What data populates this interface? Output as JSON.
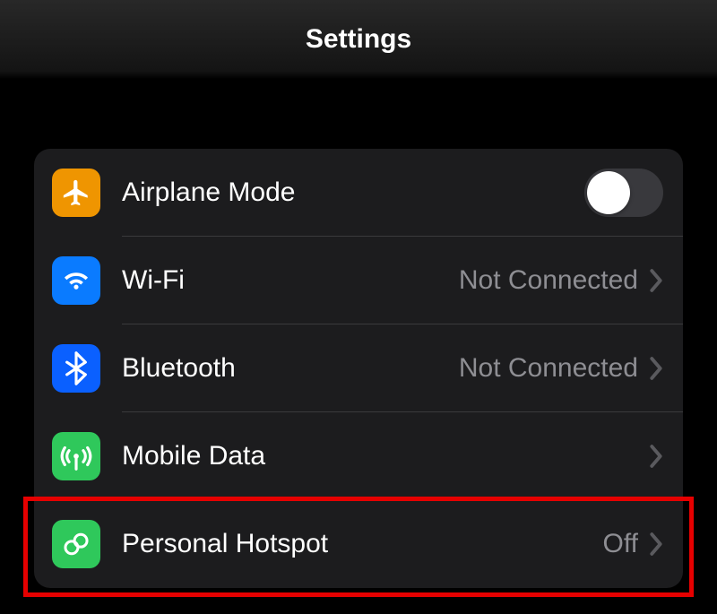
{
  "header": {
    "title": "Settings"
  },
  "rows": {
    "airplane": {
      "label": "Airplane Mode",
      "toggle": false
    },
    "wifi": {
      "label": "Wi-Fi",
      "detail": "Not Connected"
    },
    "bluetooth": {
      "label": "Bluetooth",
      "detail": "Not Connected"
    },
    "mobile": {
      "label": "Mobile Data",
      "detail": ""
    },
    "hotspot": {
      "label": "Personal Hotspot",
      "detail": "Off"
    }
  },
  "colors": {
    "airplane_icon": "#ef9501",
    "wifi_icon": "#0a7bff",
    "bluetooth_icon": "#0a60ff",
    "cellular_icon": "#2fc85b",
    "hotspot_icon": "#2fc85b",
    "highlight": "#e60000"
  },
  "highlight_target": "personal-hotspot-row"
}
